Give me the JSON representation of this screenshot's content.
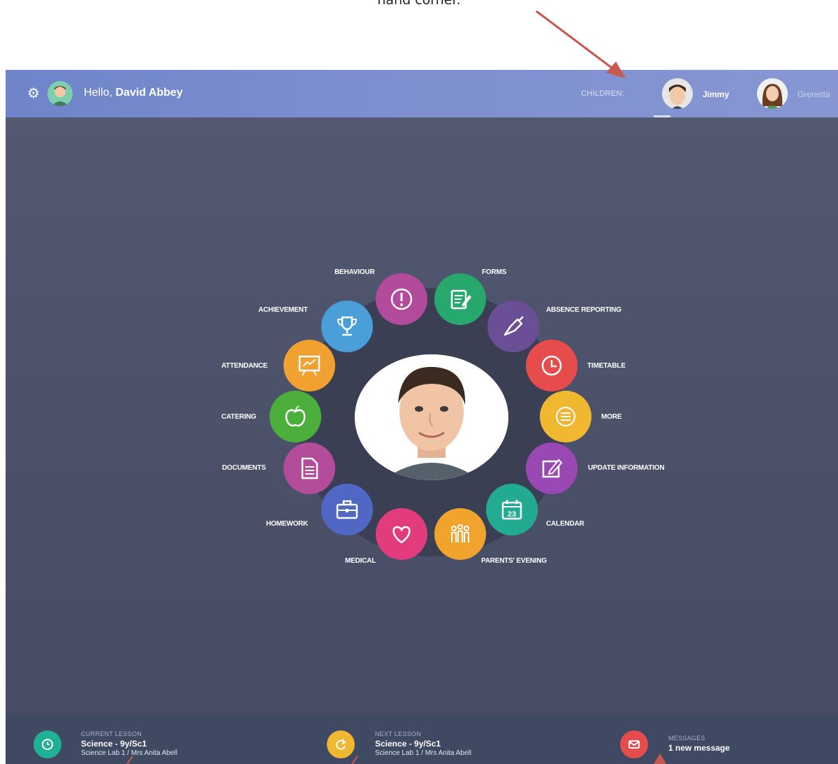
{
  "caption": "hand corner.",
  "header": {
    "greeting": "Hello,",
    "user_name": "David Abbey",
    "children_label": "CHILDREN:",
    "children": [
      {
        "name": "Jimmy",
        "active": true
      },
      {
        "name": "Grenetta",
        "active": false
      }
    ]
  },
  "menu": [
    {
      "key": "behaviour",
      "label": "BEHAVIOUR",
      "color": "#b24b9c",
      "icon": "alert-icon"
    },
    {
      "key": "forms",
      "label": "FORMS",
      "color": "#27a86c",
      "icon": "form-icon"
    },
    {
      "key": "absence",
      "label": "ABSENCE REPORTING",
      "color": "#6a4f96",
      "icon": "bell-icon"
    },
    {
      "key": "timetable",
      "label": "TIMETABLE",
      "color": "#e74c4c",
      "icon": "clock-icon"
    },
    {
      "key": "more",
      "label": "MORE",
      "color": "#f0b731",
      "icon": "more-icon"
    },
    {
      "key": "update",
      "label": "UPDATE INFORMATION",
      "color": "#9a49b4",
      "icon": "edit-icon"
    },
    {
      "key": "calendar",
      "label": "CALENDAR",
      "color": "#22ab91",
      "icon": "calendar-icon",
      "day": "23"
    },
    {
      "key": "parents",
      "label": "PARENTS' EVENING",
      "color": "#f0a42e",
      "icon": "people-icon"
    },
    {
      "key": "medical",
      "label": "MEDICAL",
      "color": "#e23c7c",
      "icon": "heart-icon"
    },
    {
      "key": "homework",
      "label": "HOMEWORK",
      "color": "#5167c6",
      "icon": "briefcase-icon"
    },
    {
      "key": "documents",
      "label": "DOCUMENTS",
      "color": "#b34c9a",
      "icon": "document-icon"
    },
    {
      "key": "catering",
      "label": "CATERING",
      "color": "#4caf3c",
      "icon": "apple-icon"
    },
    {
      "key": "attendance",
      "label": "ATTENDANCE",
      "color": "#f0a12f",
      "icon": "presentation-icon"
    },
    {
      "key": "achievement",
      "label": "ACHIEVEMENT",
      "color": "#4a9fd8",
      "icon": "trophy-icon"
    }
  ],
  "footer": {
    "current": {
      "label": "CURRENT LESSON",
      "title": "Science - 9y/Sc1",
      "detail": "Science Lab 1 / Mrs Anita Abell",
      "color": "#1fb096"
    },
    "next": {
      "label": "NEXT LESSON",
      "title": "Science - 9y/Sc1",
      "detail": "Science Lab 1 / Mrs Anita Abell",
      "color": "#f0b731"
    },
    "messages": {
      "label": "MESSAGES",
      "title": "1 new message",
      "color": "#e74c4c"
    }
  }
}
